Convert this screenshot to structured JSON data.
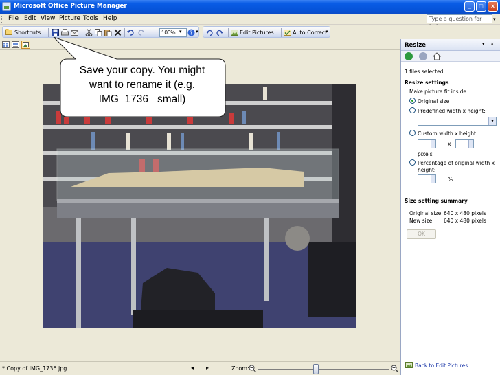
{
  "window": {
    "title": "Microsoft Office Picture Manager",
    "min_glyph": "_",
    "max_glyph": "□",
    "close_glyph": "×"
  },
  "menu": {
    "items": [
      "File",
      "Edit",
      "View",
      "Picture",
      "Tools",
      "Help"
    ],
    "help_placeholder": "Type a question for help"
  },
  "toolbar": {
    "shortcuts_label": "Shortcuts...",
    "zoom_value": "100%",
    "edit_pictures_label": "Edit Pictures...",
    "auto_correct_label": "Auto Correct"
  },
  "callout": {
    "text": "Save your copy. You might want to rename it (e.g. IMG_1736 _small)"
  },
  "status": {
    "filename": "* Copy of IMG_1736.jpg",
    "zoom_label": "Zoom:",
    "zoom_level": 0.44
  },
  "taskpane": {
    "title": "Resize",
    "files_selected": "1 files selected",
    "resize_settings_heading": "Resize settings",
    "make_fit_label": "Make picture fit inside:",
    "opt_original": "Original size",
    "opt_predefined": "Predefined width x height:",
    "opt_custom": "Custom width x height:",
    "custom_x": "x",
    "custom_pixels": "pixels",
    "opt_percentage": "Percentage of original width x height:",
    "percent_sign": "%",
    "summary_heading": "Size setting summary",
    "original_size_label": "Original size:",
    "original_size_value": "640 x 480 pixels",
    "new_size_label": "New size:",
    "new_size_value": "640 x 480 pixels",
    "ok_label": "OK",
    "back_link": "Back to Edit Pictures"
  },
  "colors": {
    "titlebar": "#0a5de6",
    "workspace": "#ece9d8",
    "link": "#1a36a8"
  }
}
